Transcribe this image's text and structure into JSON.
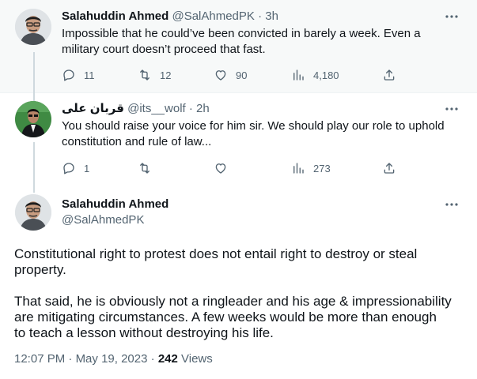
{
  "tweets": [
    {
      "name": "Salahuddin Ahmed",
      "handle": "@SalAhmedPK",
      "separator": "·",
      "time": "3h",
      "text_line1": "Impossible that he could’ve been convicted in barely a week. Even a",
      "text_line2": "military court doesn’t proceed that fast.",
      "replies": "11",
      "retweets": "12",
      "likes": "90",
      "views": "4,180"
    },
    {
      "name": "قربان علی",
      "handle": "@its__wolf",
      "separator": "·",
      "time": "2h",
      "text_line1": "You should raise your voice for him sir. We should play our role to uphold",
      "text_line2": "constitution and rule of law...",
      "replies": "1",
      "views": "273"
    }
  ],
  "main_tweet": {
    "name": "Salahuddin Ahmed",
    "handle": "@SalAhmedPK",
    "para1_line1": "Constitutional right to protest does not entail right to destroy or steal",
    "para1_line2": "property.",
    "para2_line1": "That said, he is obviously not a ringleader and his age & impressionability",
    "para2_line2": "are mitigating circumstances. A few weeks would be more than enough",
    "para2_line3": "to teach a lesson without destroying his life.",
    "time": "12:07 PM",
    "separator": "·",
    "date": "May 19, 2023",
    "separator2": "·",
    "views_count": "242",
    "views_label": "Views"
  },
  "icons": {
    "reply": "speech-bubble-icon",
    "retweet": "retweet-arrows-icon",
    "like": "heart-icon",
    "views": "bar-chart-icon",
    "share": "share-upload-icon",
    "more": "more-dots-icon"
  },
  "colors": {
    "text": "#0f1419",
    "secondary": "#536471",
    "thread_line": "#cfd9de",
    "hover_bg": "#f7f9f9"
  }
}
